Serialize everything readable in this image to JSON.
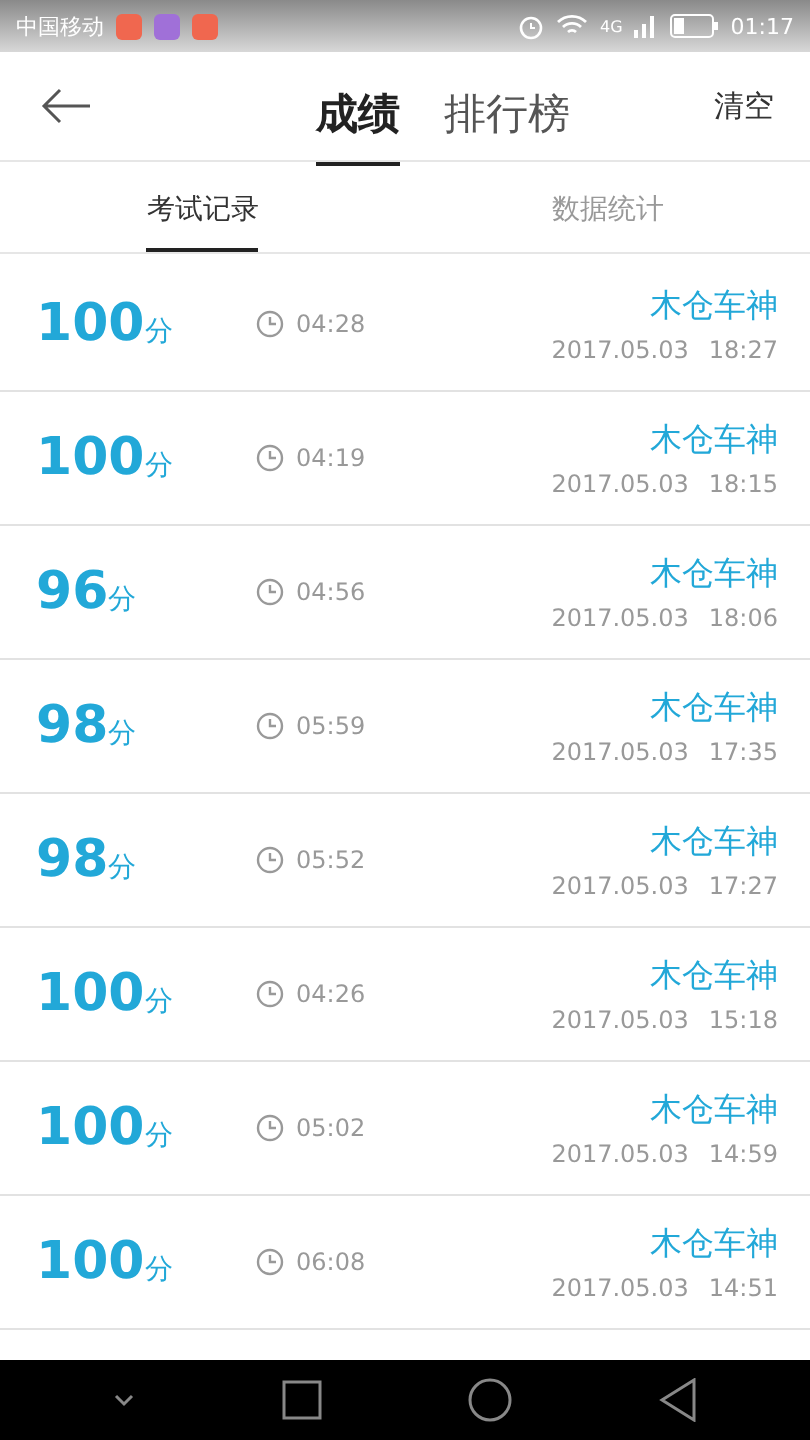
{
  "status_bar": {
    "carrier": "中国移动",
    "network": "4G",
    "time": "01:17",
    "notifications": [
      {
        "color": "#f0674f"
      },
      {
        "color": "#a070d8"
      },
      {
        "color": "#f0674f"
      }
    ]
  },
  "header": {
    "tabs": [
      {
        "label": "成绩",
        "selected": true
      },
      {
        "label": "排行榜",
        "selected": false
      }
    ],
    "action": "清空"
  },
  "subtabs": [
    {
      "label": "考试记录",
      "selected": true
    },
    {
      "label": "数据统计",
      "selected": false
    }
  ],
  "records": [
    {
      "score": "100",
      "unit": "分",
      "duration": "04:28",
      "name": "木仓车神",
      "date": "2017.05.03",
      "time": "18:27"
    },
    {
      "score": "100",
      "unit": "分",
      "duration": "04:19",
      "name": "木仓车神",
      "date": "2017.05.03",
      "time": "18:15"
    },
    {
      "score": "96",
      "unit": "分",
      "duration": "04:56",
      "name": "木仓车神",
      "date": "2017.05.03",
      "time": "18:06"
    },
    {
      "score": "98",
      "unit": "分",
      "duration": "05:59",
      "name": "木仓车神",
      "date": "2017.05.03",
      "time": "17:35"
    },
    {
      "score": "98",
      "unit": "分",
      "duration": "05:52",
      "name": "木仓车神",
      "date": "2017.05.03",
      "time": "17:27"
    },
    {
      "score": "100",
      "unit": "分",
      "duration": "04:26",
      "name": "木仓车神",
      "date": "2017.05.03",
      "time": "15:18"
    },
    {
      "score": "100",
      "unit": "分",
      "duration": "05:02",
      "name": "木仓车神",
      "date": "2017.05.03",
      "time": "14:59"
    },
    {
      "score": "100",
      "unit": "分",
      "duration": "06:08",
      "name": "木仓车神",
      "date": "2017.05.03",
      "time": "14:51"
    }
  ]
}
